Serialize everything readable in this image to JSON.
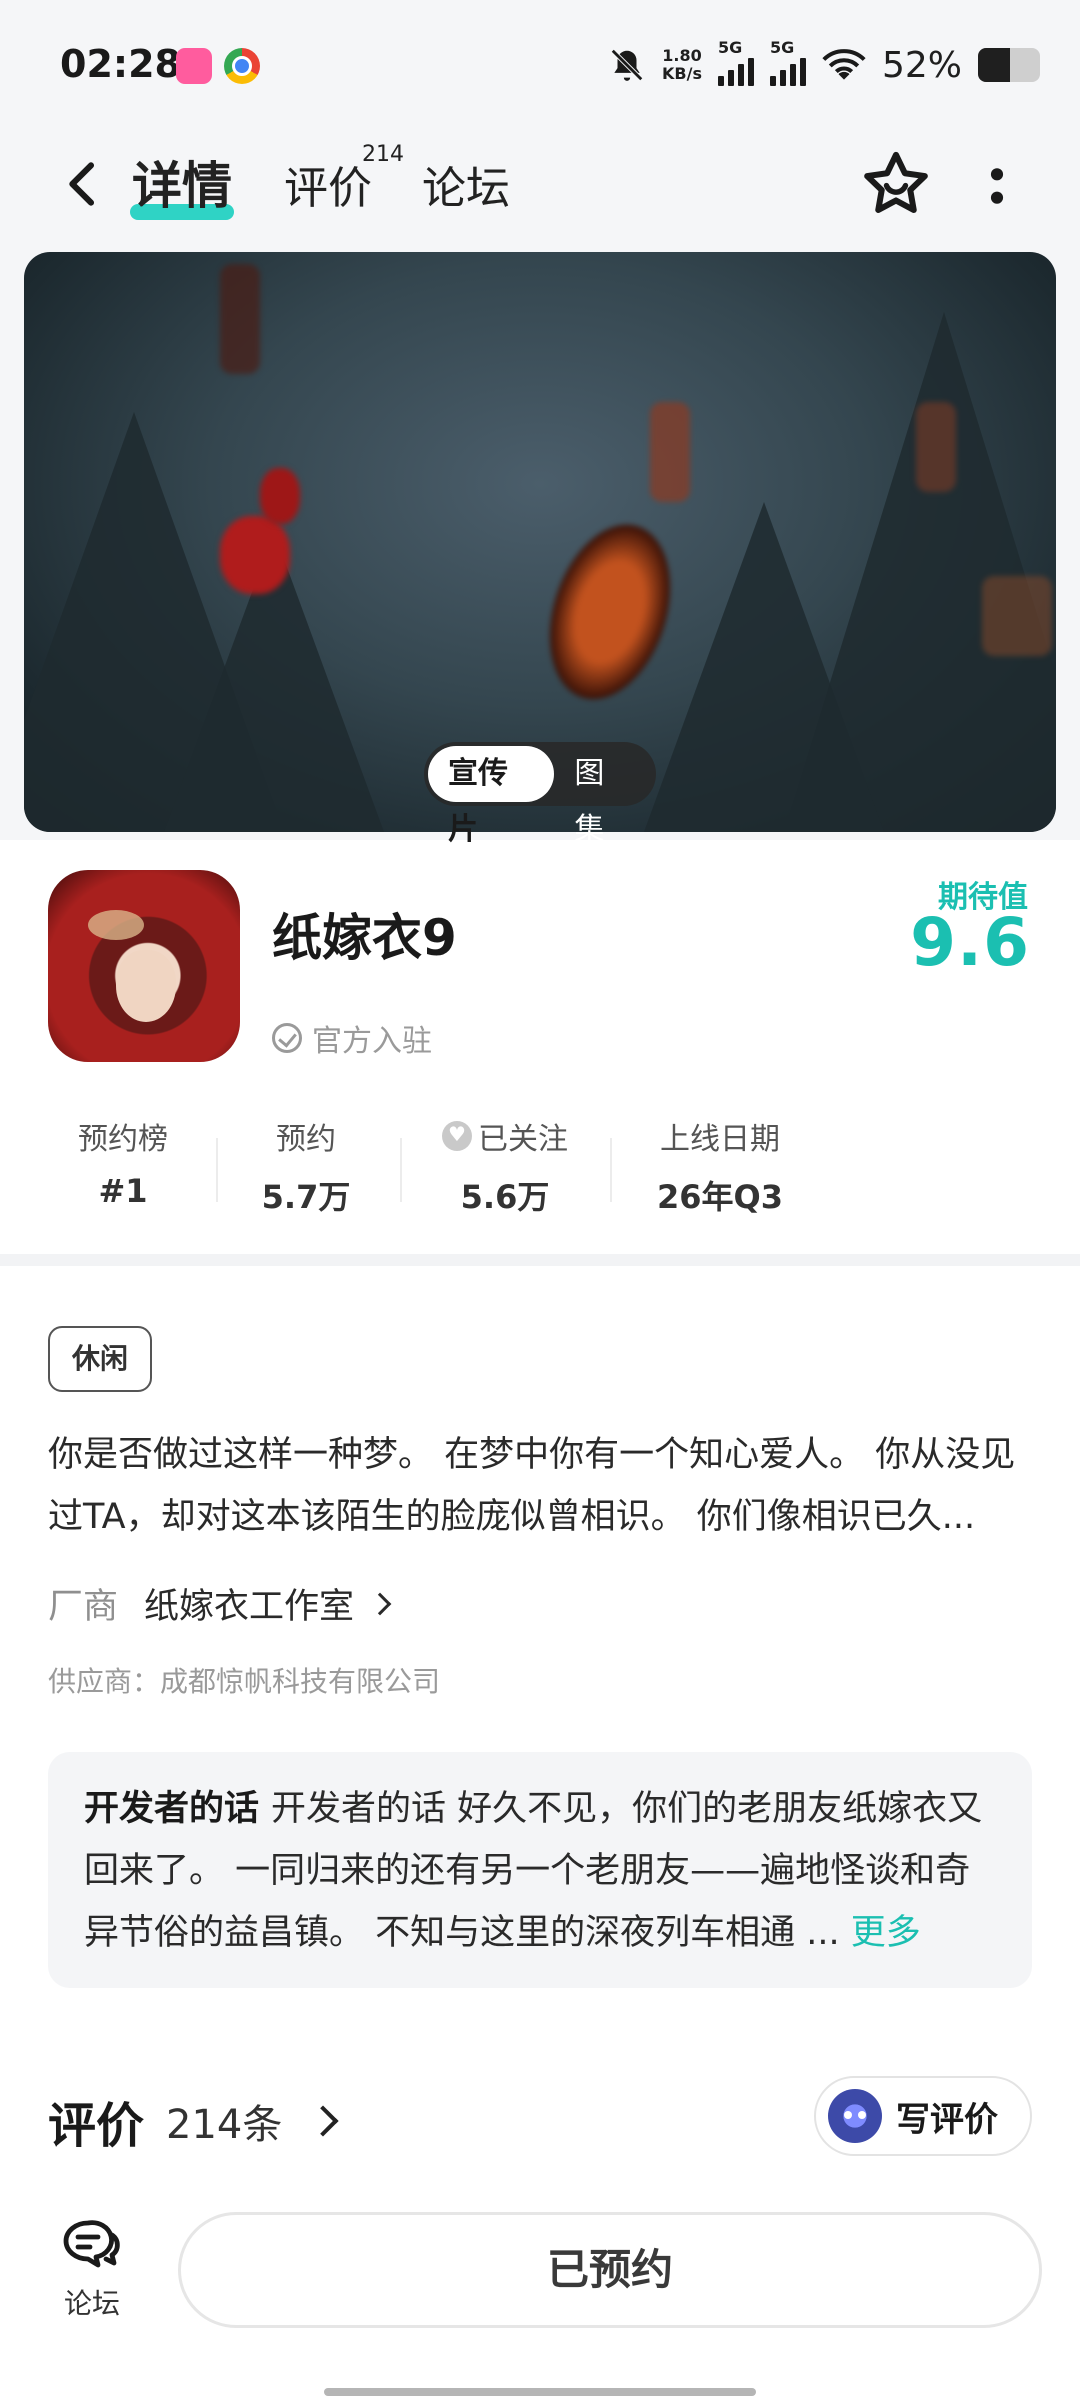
{
  "status_bar": {
    "time": "02:28",
    "net_speed_value": "1.80",
    "net_speed_unit": "KB/s",
    "signal_1_label": "5G",
    "signal_2_label": "5G",
    "battery_text": "52%",
    "battery_level": 0.52,
    "icons": [
      "bilibili-icon",
      "chrome-icon",
      "mute-icon",
      "signal-icon",
      "wifi-icon",
      "battery-icon"
    ]
  },
  "header": {
    "tabs": [
      {
        "label": "详情",
        "active": true
      },
      {
        "label": "评价",
        "badge": "214"
      },
      {
        "label": "论坛"
      }
    ],
    "accent": "#2fd3c5"
  },
  "hero": {
    "toggle": [
      {
        "label": "宣传片",
        "active": true
      },
      {
        "label": "图集"
      }
    ]
  },
  "game": {
    "title": "纸嫁衣9",
    "official_label": "官方入驻",
    "expectation_label": "期待值",
    "expectation_score": "9.6",
    "accent": "#1bbfb1"
  },
  "stats": [
    {
      "key": "预约榜",
      "value": "#1"
    },
    {
      "key": "预约",
      "value": "5.7万"
    },
    {
      "key": "已关注",
      "value": "5.6万"
    },
    {
      "key": "上线日期",
      "value": "26年Q3"
    }
  ],
  "details": {
    "tag": "休闲",
    "description": "你是否做过这样一种梦。 在梦中你有一个知心爱人。 你从没见过TA，却对这本该陌生的脸庞似曾相识。 你们像相识已久...",
    "vendor_label": "厂商",
    "vendor_name": "纸嫁衣工作室",
    "supplier": "供应商：成都惊帆科技有限公司"
  },
  "dev_note": {
    "label": "开发者的话",
    "text": "开发者的话 好久不见，你们的老朋友纸嫁衣又回来了。 一同归来的还有另一个老朋友——遍地怪谈和奇异节俗的益昌镇。 不知与这里的深夜列车相通 ...",
    "more": "更多"
  },
  "reviews": {
    "title": "评价",
    "count": "214条",
    "write_label": "写评价"
  },
  "bottom": {
    "forum_label": "论坛",
    "reserved_label": "已预约"
  }
}
